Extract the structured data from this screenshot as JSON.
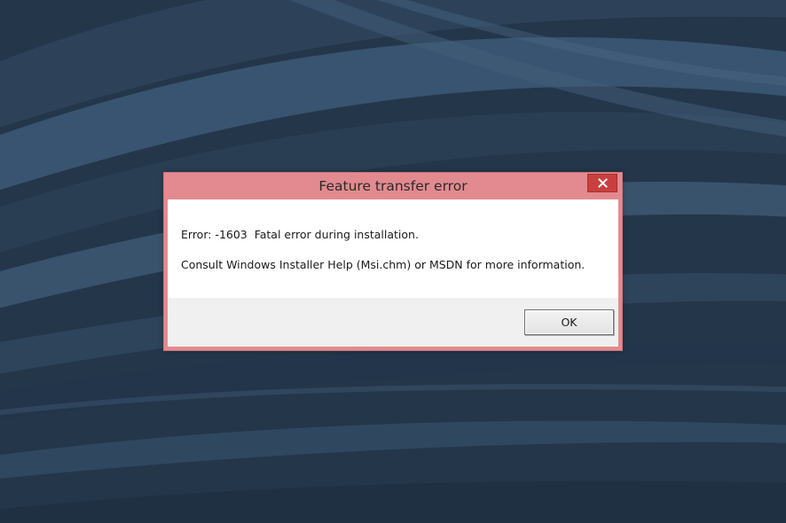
{
  "dialog": {
    "title": "Feature transfer error",
    "close_icon": "close-icon",
    "message_line1": "Error: -1603  Fatal error during installation.",
    "message_line2": "Consult Windows Installer Help (Msi.chm) or MSDN for more information.",
    "ok_label": "OK"
  },
  "colors": {
    "titlebar": "#e28a8f",
    "close_button": "#c7403f",
    "desktop": "#24364a"
  }
}
